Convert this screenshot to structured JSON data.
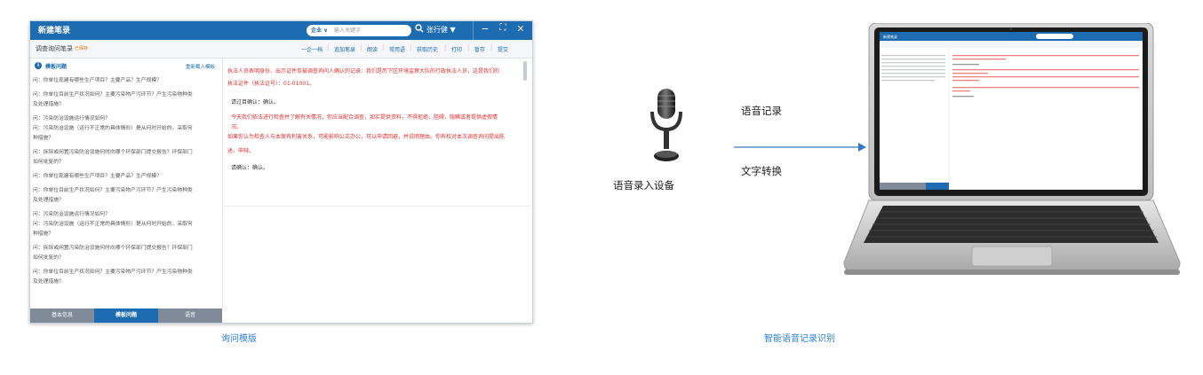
{
  "app": {
    "title": "新建笔录",
    "search_scope": "企业 ∨",
    "search_placeholder": "输入关键字",
    "user": "张行健 ▼",
    "window_controls": {
      "minimize": "−",
      "fullscreen": "⛶",
      "close": "✕"
    }
  },
  "toolbar": {
    "subtitle": "调查询问笔录",
    "badge": "已保存",
    "items": [
      "一企一档",
      "追加笔录",
      "朗读",
      "常用语",
      "获取历史",
      "打印",
      "暂存",
      "提交"
    ]
  },
  "left_panel": {
    "heading": "模板问题",
    "reload": "重新载入模板",
    "questions": [
      "问：你单位现建有哪些生产项目？主要产品？生产规模？",
      "问：你单位目前生产状况如何？主要污染物产污环节？产生污染物种类",
      "及处理措施？",
      "问：污染防治设施运行情况如何？",
      "问：污染防治设施（运行不正常的具体情形）是从何时开始的，采取何",
      "种措施？",
      "问：拆除或闲置污染防治设施何时向哪个环保部门提交报告？环保部门",
      "如何批复的？",
      "问：你单位现建有哪些生产项目？主要产品？生产规模？",
      "问：你单位目前生产状况如何？主要污染物产污环节？产生污染物种类",
      "及处理措施？",
      "问：污染防治设施运行情况如何？",
      "问：污染防治设施（运行不正常的具体情形）是从何时开始的，采取何",
      "种措施？",
      "问：拆除或闲置污染防治设施何时向哪个环保部门提交报告？环保部门",
      "如何批复的？",
      "问：你单位目前生产状况如何？主要污染物产污环节？产生污染物种类",
      "及处理措施？"
    ]
  },
  "right_panel": {
    "lines": [
      {
        "text": "执法人员表明身份、出示证件及被调查询问人确认的记录：我们是厉下区环境监察大队的行政执法人员，这是我们的",
        "color": "red"
      },
      {
        "text": "执法证件（执法证号）：01-01001。",
        "color": "red"
      },
      {
        "text": "请过目确认：确认。",
        "color": "black"
      },
      {
        "text": "今天我们依法进行检查并了解有关情况，你应当配合调查，如实提供资料，不得拒绝、阻碍、隐瞒或者提供虚假情",
        "color": "red"
      },
      {
        "text": "况。",
        "color": "red"
      },
      {
        "text": "如果你认为检查人与本案有利害关系，可能影响公正办公，可以申请回避，并说明理由。你有权对本次调查询问提出陈",
        "color": "red"
      },
      {
        "text": "述、申辩。",
        "color": "red"
      },
      {
        "text": "请确认：确认。",
        "color": "black"
      }
    ]
  },
  "tabs": [
    {
      "label": "基本信息",
      "active": false
    },
    {
      "label": "模板问题",
      "active": true
    },
    {
      "label": "语音",
      "active": false
    }
  ],
  "captions": {
    "left": "询问模版",
    "right": "智能语音记录识别"
  },
  "diagram": {
    "mic_label": "语音录入设备",
    "arrow_top": "语音记录",
    "arrow_bottom": "文字转换"
  },
  "colors": {
    "brand": "#1d6bb0",
    "accent_red": "#e03030",
    "caption": "#2f7fd8",
    "tab_inactive": "#7f8b99",
    "tab_active": "#1d6bb0"
  },
  "icons": {
    "info": "info-icon",
    "search": "search-icon",
    "mic": "microphone-icon",
    "arrow": "arrow-right-icon"
  }
}
